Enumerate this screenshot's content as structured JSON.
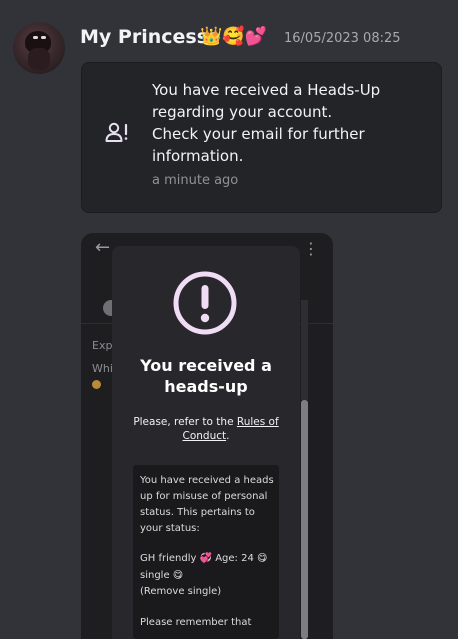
{
  "message": {
    "username": "My Princesss",
    "username_emojis": "👑🥰💕",
    "timestamp": "16/05/2023 08:25"
  },
  "notice": {
    "icon": "user-alert-icon",
    "lines": [
      "You have received a Heads-Up",
      "regarding your account.",
      "Check your email for further",
      "information."
    ],
    "time_ago": "a minute ago"
  },
  "attachment": {
    "background_left_texts": [
      "Exp",
      "Whi"
    ],
    "modal": {
      "icon": "exclamation-circle-icon",
      "title_lines": [
        "You received a",
        "heads-up"
      ],
      "refer_prefix": "Please, refer to the ",
      "refer_link_1": "Rules of",
      "refer_link_2": "Conduct",
      "refer_suffix": ".",
      "body_lines": [
        "You have received a heads",
        "up for misuse of personal",
        "status. This pertains to",
        "your status:",
        "",
        "GH friendly 💞  Age: 24 😋",
        "single 😋",
        "(Remove single)",
        "",
        "Please remember that"
      ]
    }
  },
  "colors": {
    "background": "#313338",
    "card": "#232428",
    "accent": "#f0dcf5"
  }
}
